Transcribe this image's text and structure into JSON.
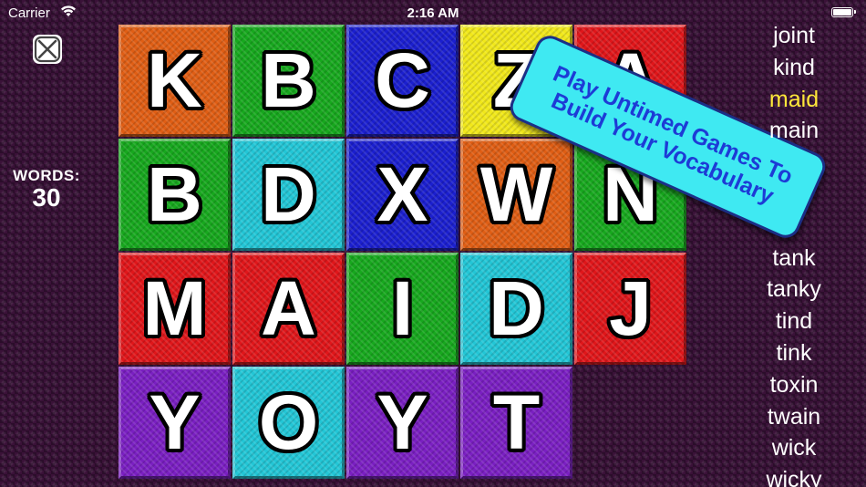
{
  "status_bar": {
    "carrier": "Carrier",
    "time": "2:16 AM",
    "wifi_icon": "wifi-icon",
    "battery_icon": "battery-icon"
  },
  "game": {
    "close_icon": "close-icon",
    "words_label": "WORDS:",
    "words_count": "30"
  },
  "board": {
    "tiles": [
      {
        "letter": "K",
        "color": "#e05e14"
      },
      {
        "letter": "B",
        "color": "#17a81e"
      },
      {
        "letter": "C",
        "color": "#1b1fcf"
      },
      {
        "letter": "Z",
        "color": "#f1e81a"
      },
      {
        "letter": "A",
        "color": "#e0161a"
      },
      {
        "letter": "B",
        "color": "#17a81e"
      },
      {
        "letter": "D",
        "color": "#22c6d6"
      },
      {
        "letter": "X",
        "color": "#1b1fcf"
      },
      {
        "letter": "W",
        "color": "#e05e14"
      },
      {
        "letter": "N",
        "color": "#17a81e"
      },
      {
        "letter": "M",
        "color": "#e0161a"
      },
      {
        "letter": "A",
        "color": "#e0161a"
      },
      {
        "letter": "I",
        "color": "#17a81e"
      },
      {
        "letter": "D",
        "color": "#22c6d6"
      },
      {
        "letter": "J",
        "color": "#e0161a"
      },
      {
        "letter": "Y",
        "color": "#7a1fc2"
      },
      {
        "letter": "O",
        "color": "#22c6d6"
      },
      {
        "letter": "Y",
        "color": "#7a1fc2"
      },
      {
        "letter": "T",
        "color": "#7a1fc2"
      }
    ]
  },
  "promo": {
    "line1": "Play Untimed Games To",
    "line2": "Build Your Vocabulary"
  },
  "word_list": {
    "highlight_color": "#ffe83a",
    "words": [
      {
        "text": "joint",
        "highlight": false
      },
      {
        "text": "kind",
        "highlight": false
      },
      {
        "text": "maid",
        "highlight": true
      },
      {
        "text": "main",
        "highlight": false
      },
      {
        "text": "",
        "highlight": false
      },
      {
        "text": "",
        "highlight": false
      },
      {
        "text": "",
        "highlight": false
      },
      {
        "text": "tank",
        "highlight": false
      },
      {
        "text": "tanky",
        "highlight": false
      },
      {
        "text": "tind",
        "highlight": false
      },
      {
        "text": "tink",
        "highlight": false
      },
      {
        "text": "toxin",
        "highlight": false
      },
      {
        "text": "twain",
        "highlight": false
      },
      {
        "text": "wick",
        "highlight": false
      },
      {
        "text": "wicky",
        "highlight": false
      }
    ]
  }
}
